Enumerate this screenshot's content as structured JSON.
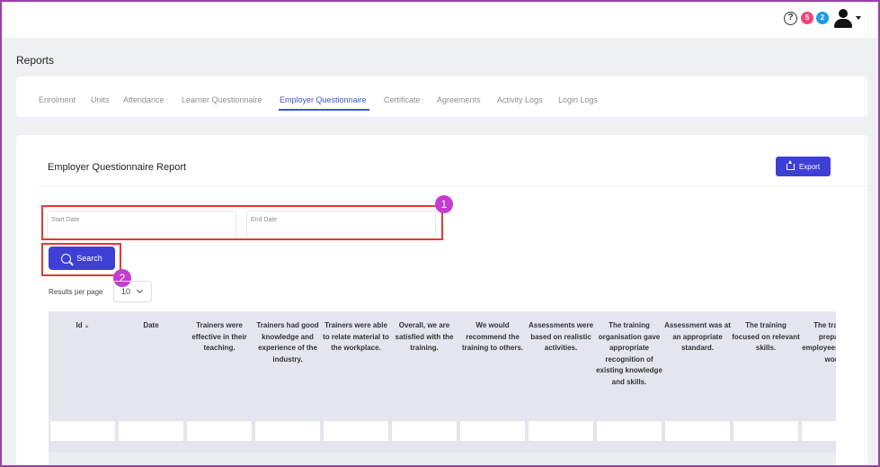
{
  "header": {
    "help_icon": "help-circle-icon",
    "notifications": [
      {
        "count": "5",
        "color": "#f0447a"
      },
      {
        "count": "2",
        "color": "#1e9be6"
      }
    ],
    "user_icon": "user-icon"
  },
  "page": {
    "title": "Reports"
  },
  "tabs": [
    {
      "label": "Enrolment"
    },
    {
      "label": "Units"
    },
    {
      "label": "Attendance"
    },
    {
      "label": "Learner Questionnaire"
    },
    {
      "label": "Employer Questionnaire",
      "active": true
    },
    {
      "label": "Certificate"
    },
    {
      "label": "Agreements"
    },
    {
      "label": "Activity Logs"
    },
    {
      "label": "Login Logs"
    }
  ],
  "report": {
    "title": "Employer Questionnaire Report",
    "export_label": "Export",
    "start_date_placeholder": "Start Date",
    "end_date_placeholder": "End Date",
    "search_label": "Search",
    "results_per_page_label": "Results per page",
    "results_per_page_value": "10"
  },
  "callouts": [
    "1",
    "2"
  ],
  "table": {
    "columns": [
      "Id",
      "Date",
      "Trainers were effective in their teaching.",
      "Trainers had good knowledge and experience of the industry.",
      "Trainers were able to relate material to the workplace.",
      "Overall, we are satisfied with the training.",
      "We would recommend the training to others.",
      "Assessments were based on realistic activities.",
      "The training organisation gave appropriate recognition of existing knowledge and skills.",
      "Assessment was at an appropriate standard.",
      "The training focused on relevant skills.",
      "The training prepared employees well for work."
    ],
    "sort_column": "Id"
  },
  "colors": {
    "primary": "#3d3fd6",
    "active_tab": "#3b57c9",
    "highlight": "#e53935",
    "callout": "#c53cd0",
    "frame": "#9b3fa8"
  }
}
